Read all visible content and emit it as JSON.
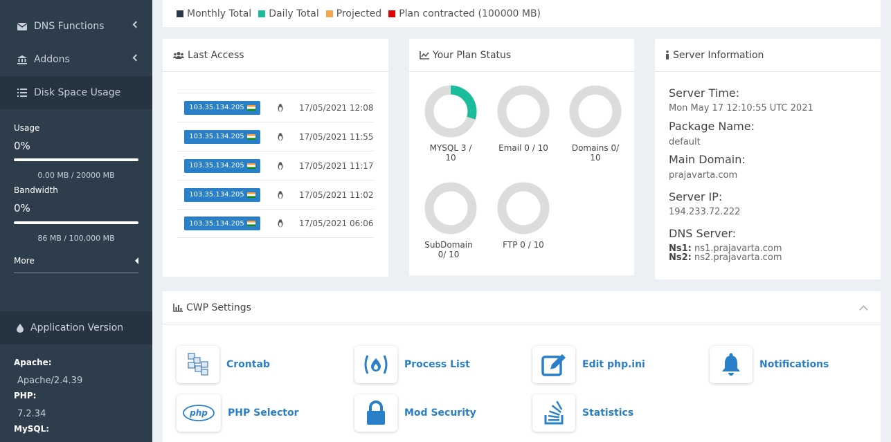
{
  "sidebar": {
    "dns_functions": "DNS Functions",
    "addons": "Addons",
    "disk_space_usage": "Disk Space Usage",
    "usage_label": "Usage",
    "usage_percent": "0%",
    "usage_value": "0.00 MB / 20000 MB",
    "bandwidth_label": "Bandwidth",
    "bandwidth_percent": "0%",
    "bandwidth_value": "86 MB / 100,000 MB",
    "more": "More",
    "application_version": "Application Version",
    "apache_label": "Apache:",
    "apache_value": "Apache/2.4.39",
    "php_label": "PHP:",
    "php_value": "7.2.34",
    "mysql_label": "MySQL:"
  },
  "legend": {
    "items": [
      {
        "label": "Monthly Total",
        "color": "#2b3a4a"
      },
      {
        "label": "Daily Total",
        "color": "#1abc9c"
      },
      {
        "label": "Projected",
        "color": "#f5a54a"
      },
      {
        "label": "Plan contracted (100000 MB)",
        "color": "#e30000"
      }
    ]
  },
  "last_access": {
    "title": "Last Access",
    "rows": [
      {
        "ip": "103.35.134.205",
        "time": "17/05/2021 12:08"
      },
      {
        "ip": "103.35.134.205",
        "time": "17/05/2021 11:55"
      },
      {
        "ip": "103.35.134.205",
        "time": "17/05/2021 11:17"
      },
      {
        "ip": "103.35.134.205",
        "time": "17/05/2021 11:02"
      },
      {
        "ip": "103.35.134.205",
        "time": "17/05/2021 06:06"
      }
    ]
  },
  "plan_status": {
    "title": "Your Plan Status",
    "accent": "#1abc9c",
    "track": "#dcdcdc",
    "items": [
      {
        "label_line1": "MYSQL 3 /",
        "label_line2": "10",
        "used": 3,
        "total": 10
      },
      {
        "label_line1": "Email 0 / 10",
        "label_line2": "",
        "used": 0,
        "total": 10
      },
      {
        "label_line1": "Domains 0/",
        "label_line2": "10",
        "used": 0,
        "total": 10
      },
      {
        "label_line1": "SubDomain",
        "label_line2": "0/ 10",
        "used": 0,
        "total": 10
      },
      {
        "label_line1": "FTP 0 / 10",
        "label_line2": "",
        "used": 0,
        "total": 10
      }
    ]
  },
  "server_info": {
    "title": "Server Information",
    "server_time_label": "Server Time:",
    "server_time": "Mon May 17 12:10:55 UTC 2021",
    "package_name_label": "Package Name:",
    "package_name": "default",
    "main_domain_label": "Main Domain:",
    "main_domain": "prajavarta.com",
    "server_ip_label": "Server IP:",
    "server_ip": "194.233.72.222",
    "dns_server_label": "DNS Server:",
    "ns1_label": "Ns1:",
    "ns1": "ns1.prajavarta.com",
    "ns2_label": "Ns2:",
    "ns2": "ns2.prajavarta.com"
  },
  "cwp_settings": {
    "title": "CWP Settings",
    "items": [
      {
        "label": "Crontab",
        "icon": "crontab-icon"
      },
      {
        "label": "Process List",
        "icon": "process-list-icon"
      },
      {
        "label": "Edit php.ini",
        "icon": "edit-icon"
      },
      {
        "label": "Notifications",
        "icon": "bell-icon"
      },
      {
        "label": "PHP Selector",
        "icon": "php-icon"
      },
      {
        "label": "Mod Security",
        "icon": "lock-icon"
      },
      {
        "label": "Statistics",
        "icon": "statistics-icon"
      }
    ]
  }
}
